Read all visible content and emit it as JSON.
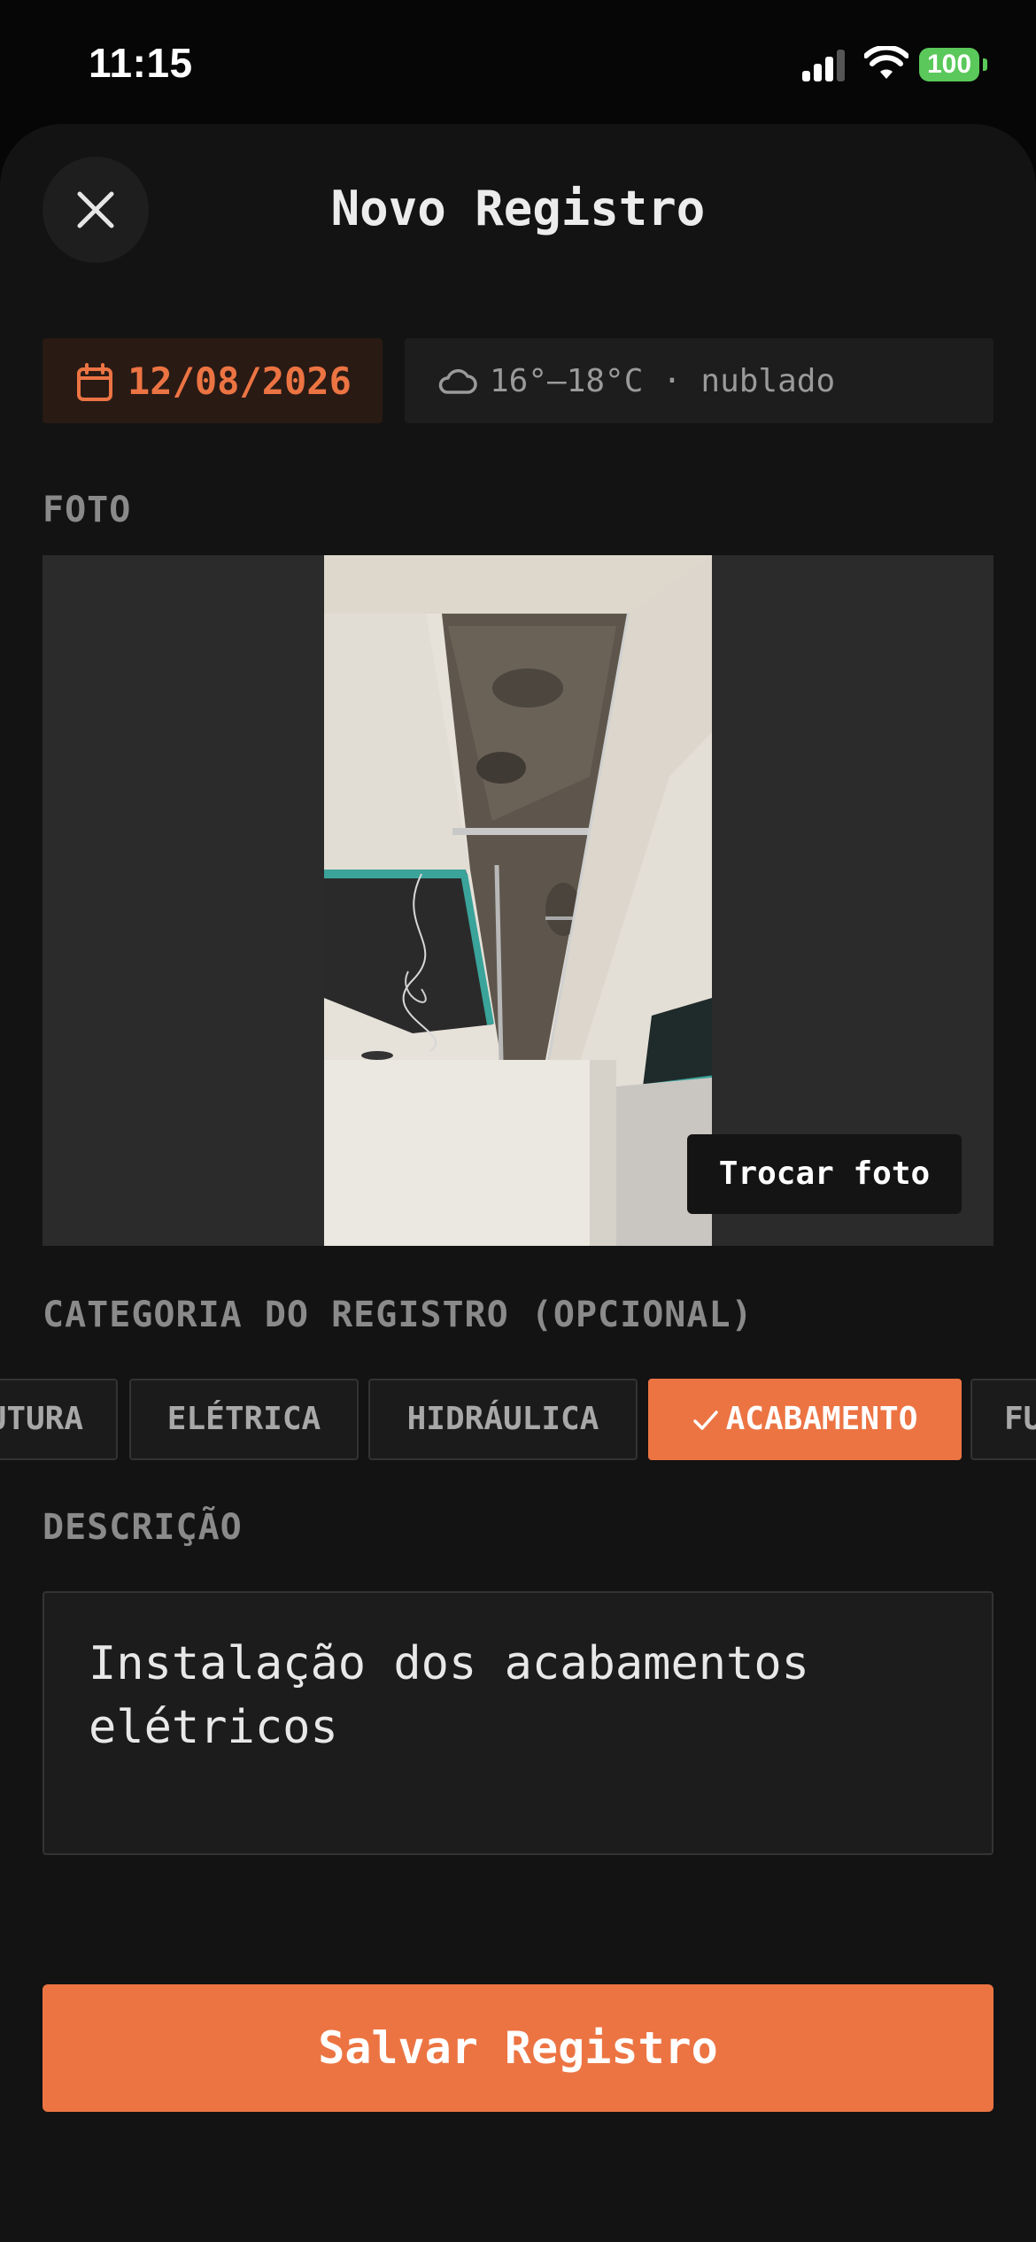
{
  "status_bar": {
    "time": "11:15",
    "battery": "100",
    "icons": [
      "signal-icon",
      "wifi-icon",
      "battery-icon"
    ]
  },
  "header": {
    "title": "Novo Registro",
    "close_icon": "close-icon"
  },
  "date": {
    "value": "12/08/2026",
    "icon": "calendar-icon"
  },
  "weather": {
    "value": "16°–18°C · nublado",
    "icon": "cloud-icon"
  },
  "photo": {
    "section_label": "FOTO",
    "swap_label": "Trocar foto"
  },
  "category": {
    "section_label": "CATEGORIA DO REGISTRO (OPCIONAL)",
    "chips": [
      {
        "label": "ESTRUTURA",
        "selected": false
      },
      {
        "label": "ELÉTRICA",
        "selected": false
      },
      {
        "label": "HIDRÁULICA",
        "selected": false
      },
      {
        "label": "ACABAMENTO",
        "selected": true
      },
      {
        "label": "FU",
        "selected": false
      }
    ]
  },
  "description": {
    "section_label": "DESCRIÇÃO",
    "value": "Instalação dos acabamentos elétricos"
  },
  "save_button": {
    "label": "Salvar Registro"
  },
  "colors": {
    "accent": "#ec7443",
    "background": "#131313",
    "battery": "#5ac85a"
  }
}
